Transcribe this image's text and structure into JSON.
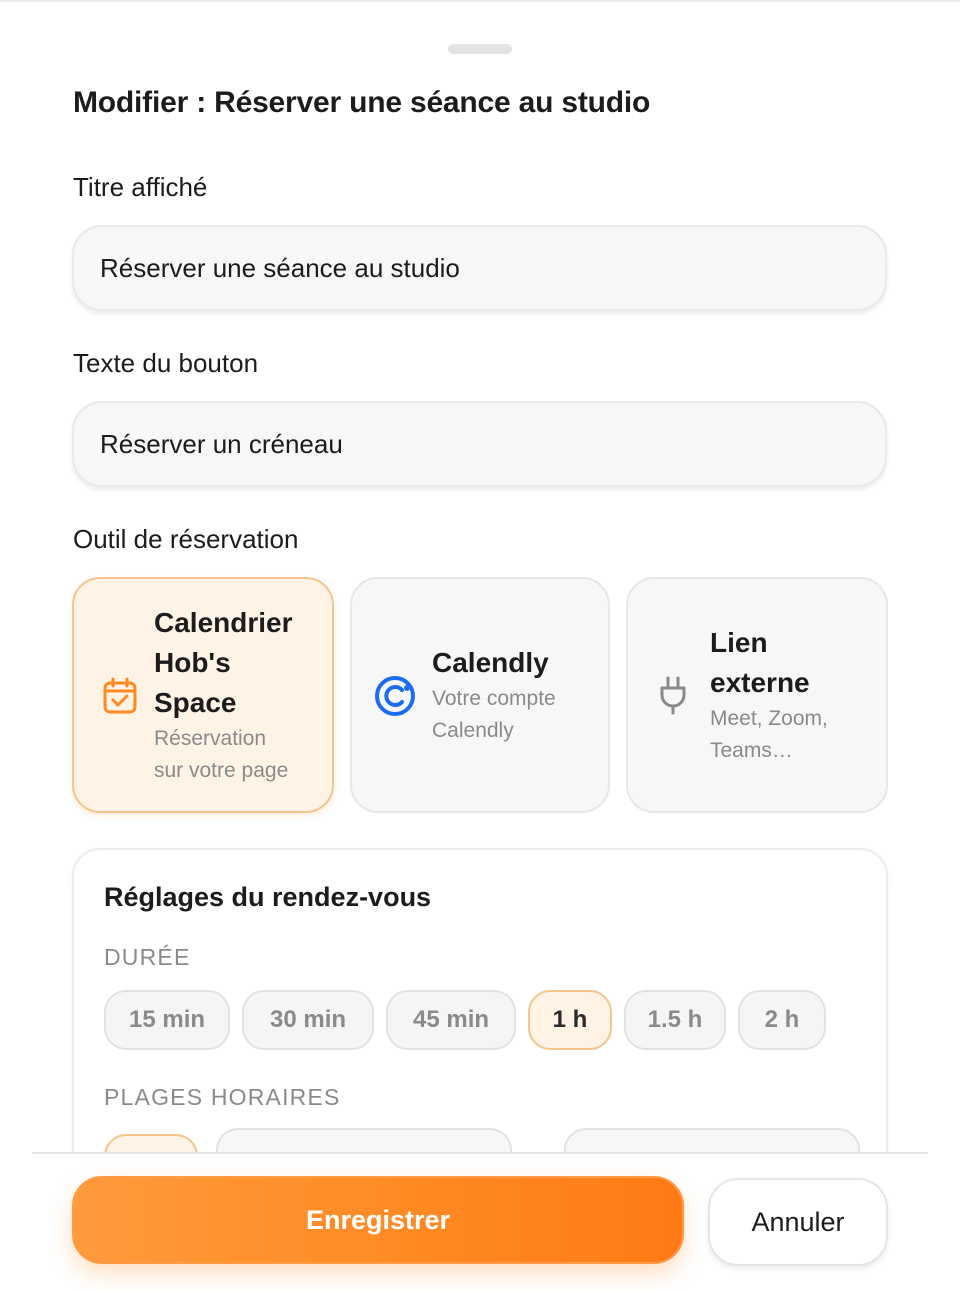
{
  "sheet": {
    "title": "Modifier : Réserver une séance au studio"
  },
  "fields": {
    "display_title": {
      "label": "Titre affiché",
      "value": "Réserver une séance au studio"
    },
    "button_text": {
      "label": "Texte du bouton",
      "value": "Réserver un créneau"
    }
  },
  "booking_tool": {
    "label": "Outil de réservation",
    "selected": "hobs-space",
    "options": [
      {
        "id": "hobs-space",
        "icon": "calendar-check-icon",
        "name_lines": [
          "Calendrier",
          "Hob's",
          "Space"
        ],
        "desc_lines": [
          "Réservation",
          "sur votre page"
        ]
      },
      {
        "id": "calendly",
        "icon": "calendly-logo-icon",
        "name_lines": [
          "Calendly"
        ],
        "desc_lines": [
          "Votre compte",
          "Calendly"
        ]
      },
      {
        "id": "external",
        "icon": "plug-icon",
        "name_lines": [
          "Lien",
          "externe"
        ],
        "desc_lines": [
          "Meet, Zoom,",
          "Teams…"
        ]
      }
    ]
  },
  "appointment_settings": {
    "title": "Réglages du rendez-vous",
    "duration_label": "DURÉE",
    "durations": [
      "15 min",
      "30 min",
      "45 min",
      "1 h",
      "1.5 h",
      "2 h"
    ],
    "selected_duration": "1 h",
    "time_slots_label": "PLAGES HORAIRES"
  },
  "actions": {
    "save_label": "Enregistrer",
    "cancel_label": "Annuler"
  },
  "colors": {
    "accent": "#ff8a22",
    "accent_light": "#fff3e5",
    "accent_border": "#f6c48c",
    "calendly_blue": "#1a6cf0",
    "muted_text": "#8a8a8a"
  }
}
